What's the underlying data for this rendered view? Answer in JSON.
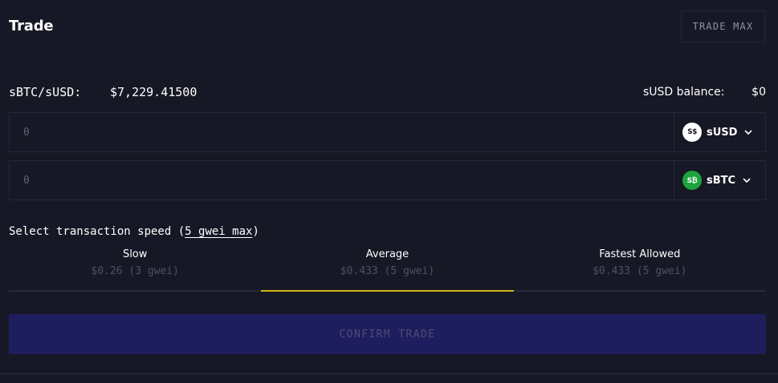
{
  "header": {
    "title": "Trade",
    "trade_max_label": "TRADE MAX"
  },
  "rate": {
    "pair": "sBTC/sUSD:",
    "value": "$7,229.41500"
  },
  "balance": {
    "label": "sUSD balance:",
    "value": "$0"
  },
  "inputs": [
    {
      "placeholder": "0",
      "token": "sUSD",
      "icon": "susd-icon",
      "icon_text": "S$",
      "icon_color": "#ffffff"
    },
    {
      "placeholder": "0",
      "token": "sBTC",
      "icon": "sbtc-icon",
      "icon_text": "S₿",
      "icon_color": "#1ea43b"
    }
  ],
  "speed": {
    "label_prefix": "Select transaction speed (",
    "label_link": "5 gwei max",
    "label_suffix": ")",
    "options": [
      {
        "title": "Slow",
        "price": "$0.26 (3 gwei)",
        "selected": false
      },
      {
        "title": "Average",
        "price": "$0.433 (5 gwei)",
        "selected": true
      },
      {
        "title": "Fastest Allowed",
        "price": "$0.433 (5 gwei)",
        "selected": false
      }
    ]
  },
  "confirm_label": "CONFIRM TRADE",
  "colors": {
    "background": "#171825",
    "accent_underline": "#d4b418",
    "confirm_button": "#1e1e5e"
  }
}
